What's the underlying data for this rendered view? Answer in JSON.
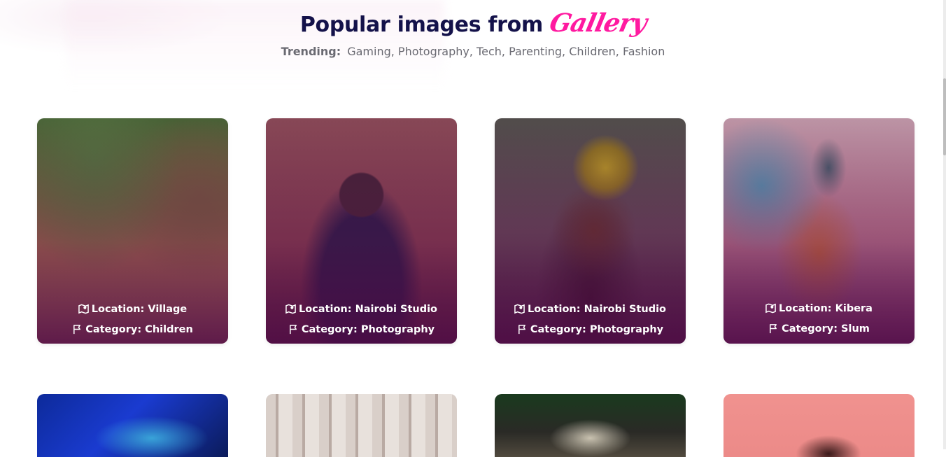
{
  "header": {
    "title": "Popular images from",
    "brand": "Gallery",
    "trending_label": "Trending:",
    "trending_tags": [
      "Gaming",
      "Photography",
      "Tech",
      "Parenting",
      "Children",
      "Fashion"
    ]
  },
  "cards": [
    {
      "location": "Location: Village",
      "category": "Category: Children"
    },
    {
      "location": "Location: Nairobi Studio",
      "category": "Category: Photography"
    },
    {
      "location": "Location: Nairobi Studio",
      "category": "Category: Photography"
    },
    {
      "location": "Location: Kibera",
      "category": "Category: Slum"
    }
  ],
  "colors": {
    "title": "#14124a",
    "brand": "#ff1aa0",
    "muted_text": "#6a6a72"
  },
  "icons": {
    "location": "map-icon",
    "category": "flag-icon"
  }
}
